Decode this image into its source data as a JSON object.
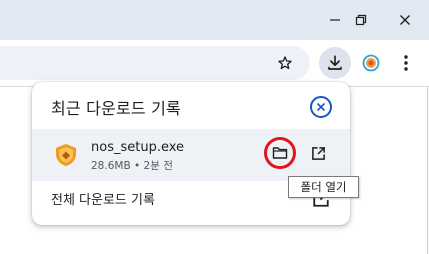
{
  "window": {
    "controls": {
      "minimize_icon": "minimize-icon",
      "restore_icon": "restore-icon",
      "close_icon": "close-icon"
    }
  },
  "toolbar": {
    "bookmark_icon": "star-icon",
    "download_icon": "download-icon",
    "extension_icon": "extension-icon",
    "menu_icon": "more-vert-icon"
  },
  "downloads_popup": {
    "title": "최근 다운로드 기록",
    "close_icon": "close-circle-icon",
    "items": [
      {
        "file_name": "nos_setup.exe",
        "meta": "28.6MB • 2분 전",
        "file_icon": "shield-app-icon",
        "folder_icon": "folder-icon",
        "open_icon": "open-external-icon"
      }
    ],
    "all_downloads_label": "전체 다운로드 기록"
  },
  "tooltip": {
    "text": "폴더 열기"
  },
  "colors": {
    "accent_blue": "#1a56c8",
    "highlight_red": "#e0161f",
    "item_bg": "#eef1f6"
  }
}
